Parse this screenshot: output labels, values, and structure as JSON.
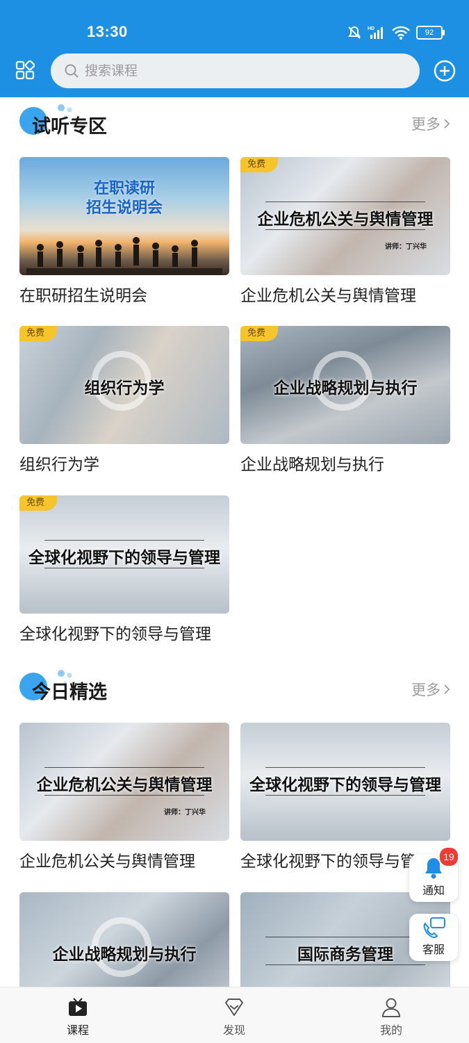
{
  "status_bar": {
    "time": "13:30",
    "battery": "92"
  },
  "header": {
    "search_placeholder": "搜索课程"
  },
  "sections": [
    {
      "title": "试听专区",
      "more": "更多",
      "cards": [
        {
          "thumb_title_line1": "在职读研",
          "thumb_title_line2": "招生说明会",
          "caption": "在职研招生说明会",
          "free": ""
        },
        {
          "thumb_title": "企业危机公关与舆情管理",
          "lecturer": "讲师：丁兴华",
          "caption": "企业危机公关与舆情管理",
          "free": "免费"
        },
        {
          "thumb_title": "组织行为学",
          "caption": "组织行为学",
          "free": "免费"
        },
        {
          "thumb_title": "企业战略规划与执行",
          "caption": "企业战略规划与执行",
          "free": "免费"
        },
        {
          "thumb_title": "全球化视野下的领导与管理",
          "caption": "全球化视野下的领导与管理",
          "free": "免费"
        }
      ]
    },
    {
      "title": "今日精选",
      "more": "更多",
      "cards": [
        {
          "thumb_title": "企业危机公关与舆情管理",
          "lecturer": "讲师：丁兴华",
          "caption": "企业危机公关与舆情管理"
        },
        {
          "thumb_title": "全球化视野下的领导与管理",
          "caption": "全球化视野下的领导与管理"
        },
        {
          "thumb_title": "企业战略规划与执行"
        },
        {
          "thumb_title": "国际商务管理"
        }
      ]
    }
  ],
  "floating": {
    "notify_label": "通知",
    "notify_count": "19",
    "service_label": "客服"
  },
  "bottom_nav": {
    "items": [
      {
        "label": "课程",
        "icon": "tv-play-icon",
        "active": true
      },
      {
        "label": "发现",
        "icon": "diamond-icon",
        "active": false
      },
      {
        "label": "我的",
        "icon": "person-icon",
        "active": false
      }
    ]
  },
  "colors": {
    "primary": "#1e90e3",
    "free_badge": "#f6c42b",
    "badge_red": "#ef3b35"
  }
}
